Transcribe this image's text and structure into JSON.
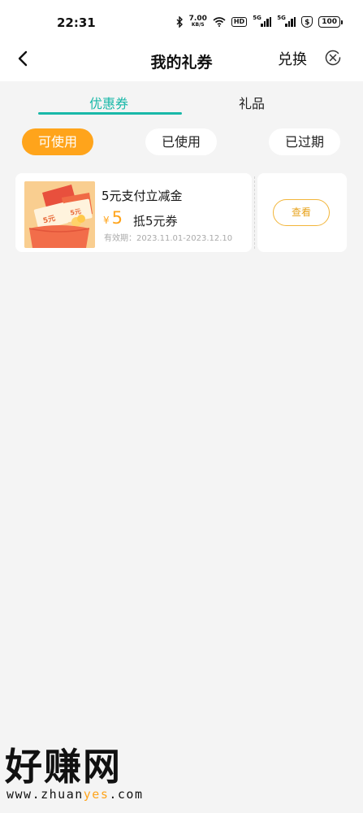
{
  "status_bar": {
    "time": "22:31",
    "net_speed_value": "7.00",
    "net_speed_unit": "KB/S",
    "hd_label": "HD",
    "signal1_label": "5G",
    "signal2_label": "5G",
    "shield_label": "$",
    "battery": "100"
  },
  "navbar": {
    "title": "我的礼券",
    "exchange_label": "兑换"
  },
  "tabs": [
    {
      "label": "优惠券",
      "active": true
    },
    {
      "label": "礼品",
      "active": false
    }
  ],
  "filters": [
    {
      "label": "可使用",
      "active": true
    },
    {
      "label": "已使用",
      "active": false
    },
    {
      "label": "已过期",
      "active": false
    }
  ],
  "coupons": [
    {
      "name": "5元支付立减金",
      "currency": "¥",
      "amount": "5",
      "description": "抵5元券",
      "validity": "有效期：2023.11.01-2023.12.10",
      "action_label": "查看"
    }
  ],
  "watermark": {
    "logo": "好赚网",
    "url_prefix": "www.zhuan",
    "url_highlight": "yes",
    "url_suffix": ".com"
  },
  "colors": {
    "accent_teal": "#19b8a8",
    "accent_orange": "#ffa41b",
    "background": "#f4f4f4"
  }
}
